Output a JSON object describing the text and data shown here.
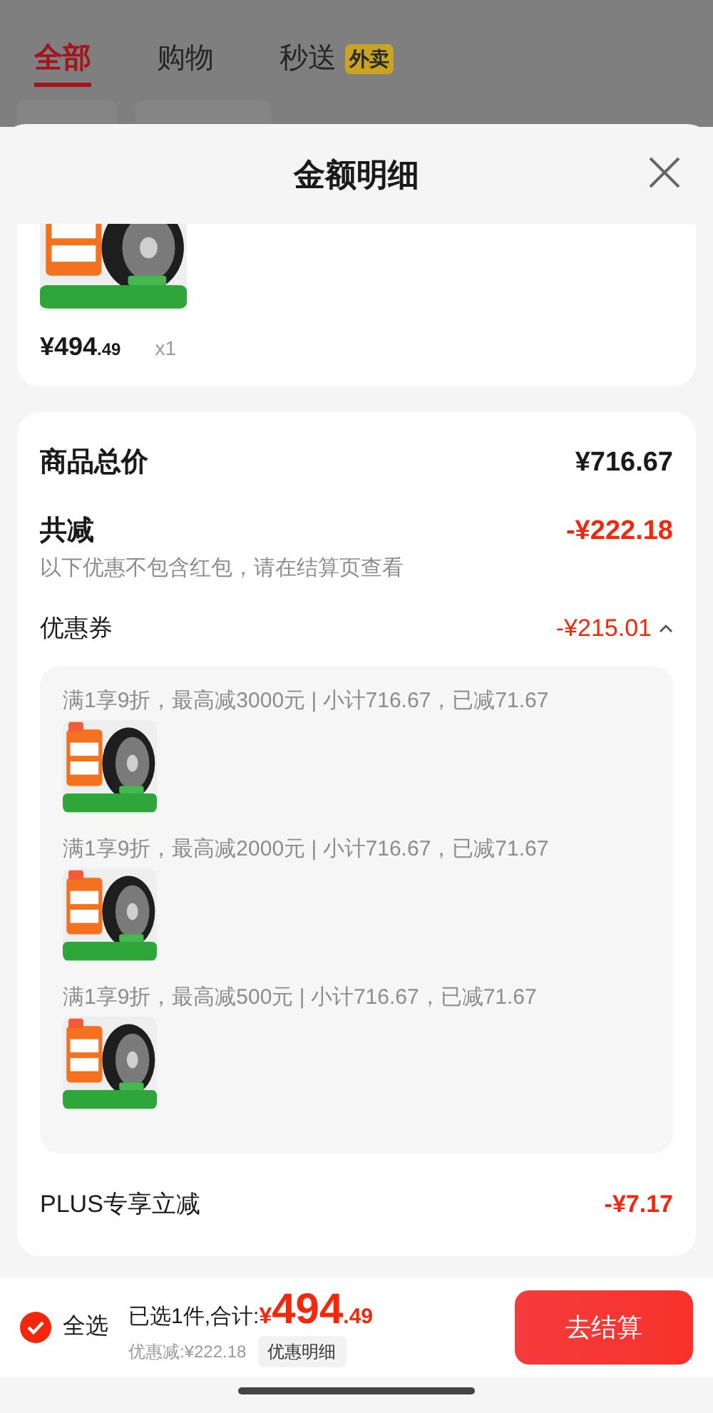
{
  "background_tabs": [
    {
      "label": "全部",
      "selected": true
    },
    {
      "label": "购物",
      "selected": false
    },
    {
      "label": "秒送",
      "selected": false,
      "badge": "外卖"
    }
  ],
  "background_filters": [
    {
      "kind": "chip"
    },
    {
      "kind": "chip"
    }
  ],
  "sheet": {
    "title": "金额明细"
  },
  "product": {
    "price_main": "¥494",
    "price_decimal": ".49",
    "quantity": "x1"
  },
  "summary": {
    "total_label": "商品总价",
    "total_value": "¥716.67",
    "reduction_label": "共减",
    "reduction_value": "-¥222.18",
    "reduction_note": "以下优惠不包含红包，请在结算页查看"
  },
  "coupon": {
    "label": "优惠券",
    "value": "-¥215.01",
    "expanded": true,
    "items": [
      {
        "text": "满1享9折，最高减3000元 | 小计716.67，已减71.67"
      },
      {
        "text": "满1享9折，最高减2000元 | 小计716.67，已减71.67"
      },
      {
        "text": "满1享9折，最高减500元 | 小计716.67，已减71.67"
      }
    ]
  },
  "plus": {
    "label": "PLUS专享立减",
    "value": "-¥7.17"
  },
  "bottom_bar": {
    "select_all": {
      "label": "全选",
      "checked": true
    },
    "selected_total_label": "已选1件,合计:",
    "currency": "¥",
    "amount_main": "494",
    "amount_decimal": ".49",
    "discount": "优惠减:¥222.18",
    "detail_button": "优惠明细",
    "checkout_button": "去结算"
  }
}
